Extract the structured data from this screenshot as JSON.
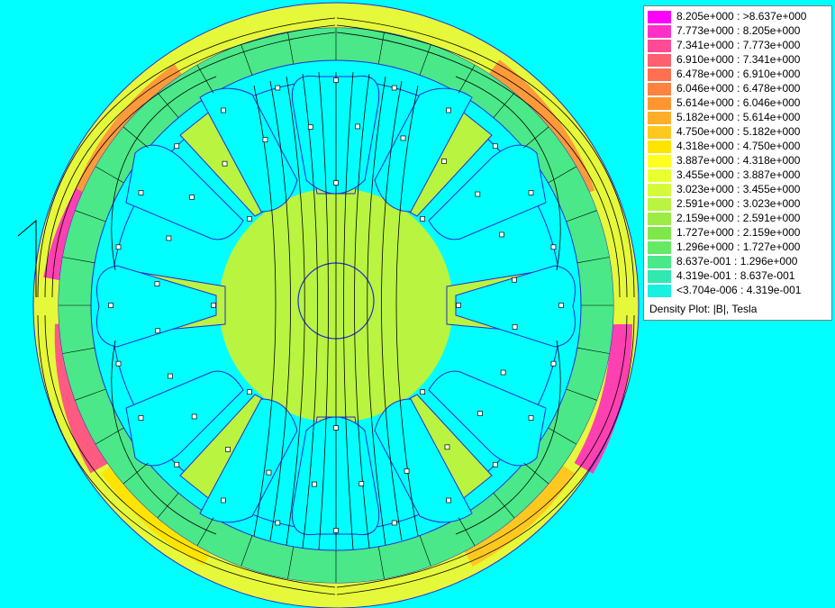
{
  "plot": {
    "background": "#00ffff",
    "caption": "Density Plot: |B|, Tesla",
    "legend": [
      {
        "label": "8.205e+000 : >8.637e+000",
        "color": "#ff00ff"
      },
      {
        "label": "7.773e+000 : 8.205e+000",
        "color": "#ff30c8"
      },
      {
        "label": "7.341e+000 : 7.773e+000",
        "color": "#ff4a96"
      },
      {
        "label": "6.910e+000 : 7.341e+000",
        "color": "#ff5f6e"
      },
      {
        "label": "6.478e+000 : 6.910e+000",
        "color": "#ff7050"
      },
      {
        "label": "6.046e+000 : 6.478e+000",
        "color": "#ff8240"
      },
      {
        "label": "5.614e+000 : 6.046e+000",
        "color": "#ff9632"
      },
      {
        "label": "5.182e+000 : 5.614e+000",
        "color": "#ffae28"
      },
      {
        "label": "4.750e+000 : 5.182e+000",
        "color": "#ffc820"
      },
      {
        "label": "4.318e+000 : 4.750e+000",
        "color": "#ffe400"
      },
      {
        "label": "3.887e+000 : 4.318e+000",
        "color": "#ffff20"
      },
      {
        "label": "3.455e+000 : 3.887e+000",
        "color": "#eaff30"
      },
      {
        "label": "3.023e+000 : 3.455e+000",
        "color": "#d4fa3a"
      },
      {
        "label": "2.591e+000 : 3.023e+000",
        "color": "#b8f440"
      },
      {
        "label": "2.159e+000 : 2.591e+000",
        "color": "#9cec44"
      },
      {
        "label": "1.727e+000 : 2.159e+000",
        "color": "#7ee84a"
      },
      {
        "label": "1.296e+000 : 1.727e+000",
        "color": "#66ea66"
      },
      {
        "label": "8.637e-001 : 1.296e+000",
        "color": "#4ae888"
      },
      {
        "label": "4.319e-001 : 8.637e-001",
        "color": "#30e8b0"
      },
      {
        "label": "<3.704e-006 : 4.319e-001",
        "color": "#18f0e0"
      }
    ]
  }
}
